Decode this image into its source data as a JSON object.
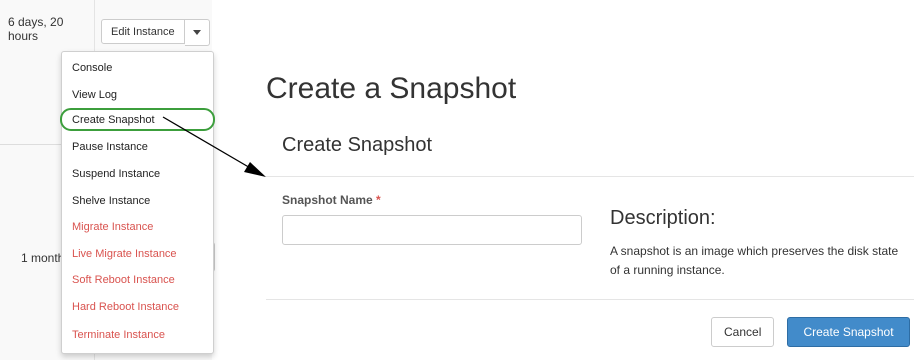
{
  "table": {
    "rows": [
      {
        "uptime": "6 days, 20 hours"
      },
      {
        "uptime": "1 month"
      }
    ]
  },
  "actions": {
    "edit_label": "Edit Instance",
    "caret_icon": "chevron-down-icon",
    "menu": [
      {
        "label": "Console",
        "danger": false,
        "highlighted": false
      },
      {
        "label": "View Log",
        "danger": false,
        "highlighted": false
      },
      {
        "label": "Create Snapshot",
        "danger": false,
        "highlighted": true
      },
      {
        "label": "Pause Instance",
        "danger": false,
        "highlighted": false
      },
      {
        "label": "Suspend Instance",
        "danger": false,
        "highlighted": false
      },
      {
        "label": "Shelve Instance",
        "danger": false,
        "highlighted": false
      },
      {
        "label": "Migrate Instance",
        "danger": true,
        "highlighted": false
      },
      {
        "label": "Live Migrate Instance",
        "danger": true,
        "highlighted": false
      },
      {
        "label": "Soft Reboot Instance",
        "danger": true,
        "highlighted": false
      },
      {
        "label": "Hard Reboot Instance",
        "danger": true,
        "highlighted": false
      },
      {
        "label": "Terminate Instance",
        "danger": true,
        "highlighted": false
      }
    ]
  },
  "panel": {
    "page_title": "Create a Snapshot",
    "modal_title": "Create Snapshot",
    "name_label": "Snapshot Name",
    "required_mark": "*",
    "name_value": "",
    "description_title": "Description:",
    "description_text": "A snapshot is an image which preserves the disk state of a running instance.",
    "cancel_label": "Cancel",
    "submit_label": "Create Snapshot"
  },
  "colors": {
    "primary": "#428bca",
    "danger": "#d9534f",
    "highlight": "#3c9e3c"
  }
}
